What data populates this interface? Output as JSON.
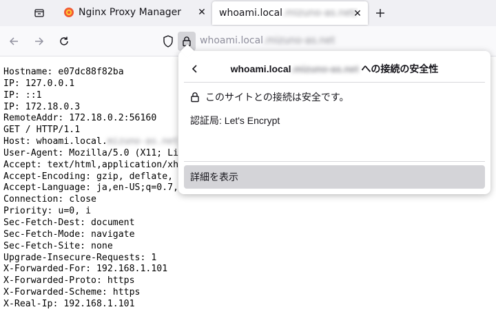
{
  "tabs": [
    {
      "title": "Nginx Proxy Manager",
      "active": false,
      "favicon": "nginx-proxy-manager-icon"
    },
    {
      "title": "whoami.local",
      "title_blurred": ".mizuno-as.net/",
      "active": true
    }
  ],
  "urlbar": {
    "host": "whoami.local",
    "host_blurred": ".mizuno-as.net"
  },
  "page": {
    "lines": [
      "Hostname: e07dc88f82ba",
      "IP: 127.0.0.1",
      "IP: ::1",
      "IP: 172.18.0.3",
      "RemoteAddr: 172.18.0.2:56160",
      "GET / HTTP/1.1",
      "Host: whoami.local.",
      "User-Agent: Mozilla/5.0 (X11; Li",
      "Accept: text/html,application/xh",
      "Accept-Encoding: gzip, deflate,",
      "Accept-Language: ja,en-US;q=0.7,",
      "Connection: close",
      "Priority: u=0, i",
      "Sec-Fetch-Dest: document",
      "Sec-Fetch-Mode: navigate",
      "Sec-Fetch-Site: none",
      "Upgrade-Insecure-Requests: 1",
      "X-Forwarded-For: 192.168.1.101",
      "X-Forwarded-Proto: https",
      "X-Forwarded-Scheme: https",
      "X-Real-Ip: 192.168.1.101"
    ],
    "host_blurred": "mizuno-as.net"
  },
  "panel": {
    "title_host": "whoami.local",
    "title_blurred": ".mizuno-as.net",
    "title_suffix": " への接続の安全性",
    "secure_text": "このサイトとの接続は安全です。",
    "issuer": "認証局: Let's Encrypt",
    "details_button": "詳細を表示"
  }
}
